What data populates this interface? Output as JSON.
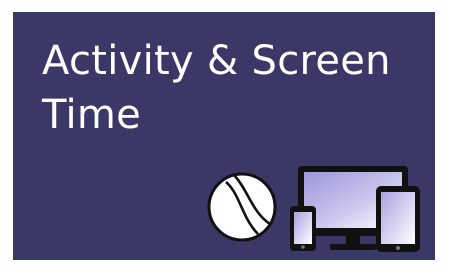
{
  "tile": {
    "title_line1": "Activity & Screen",
    "title_line2": "Time",
    "background_color": "#3b3767",
    "icons": [
      "tennis-ball-icon",
      "devices-icon"
    ]
  }
}
